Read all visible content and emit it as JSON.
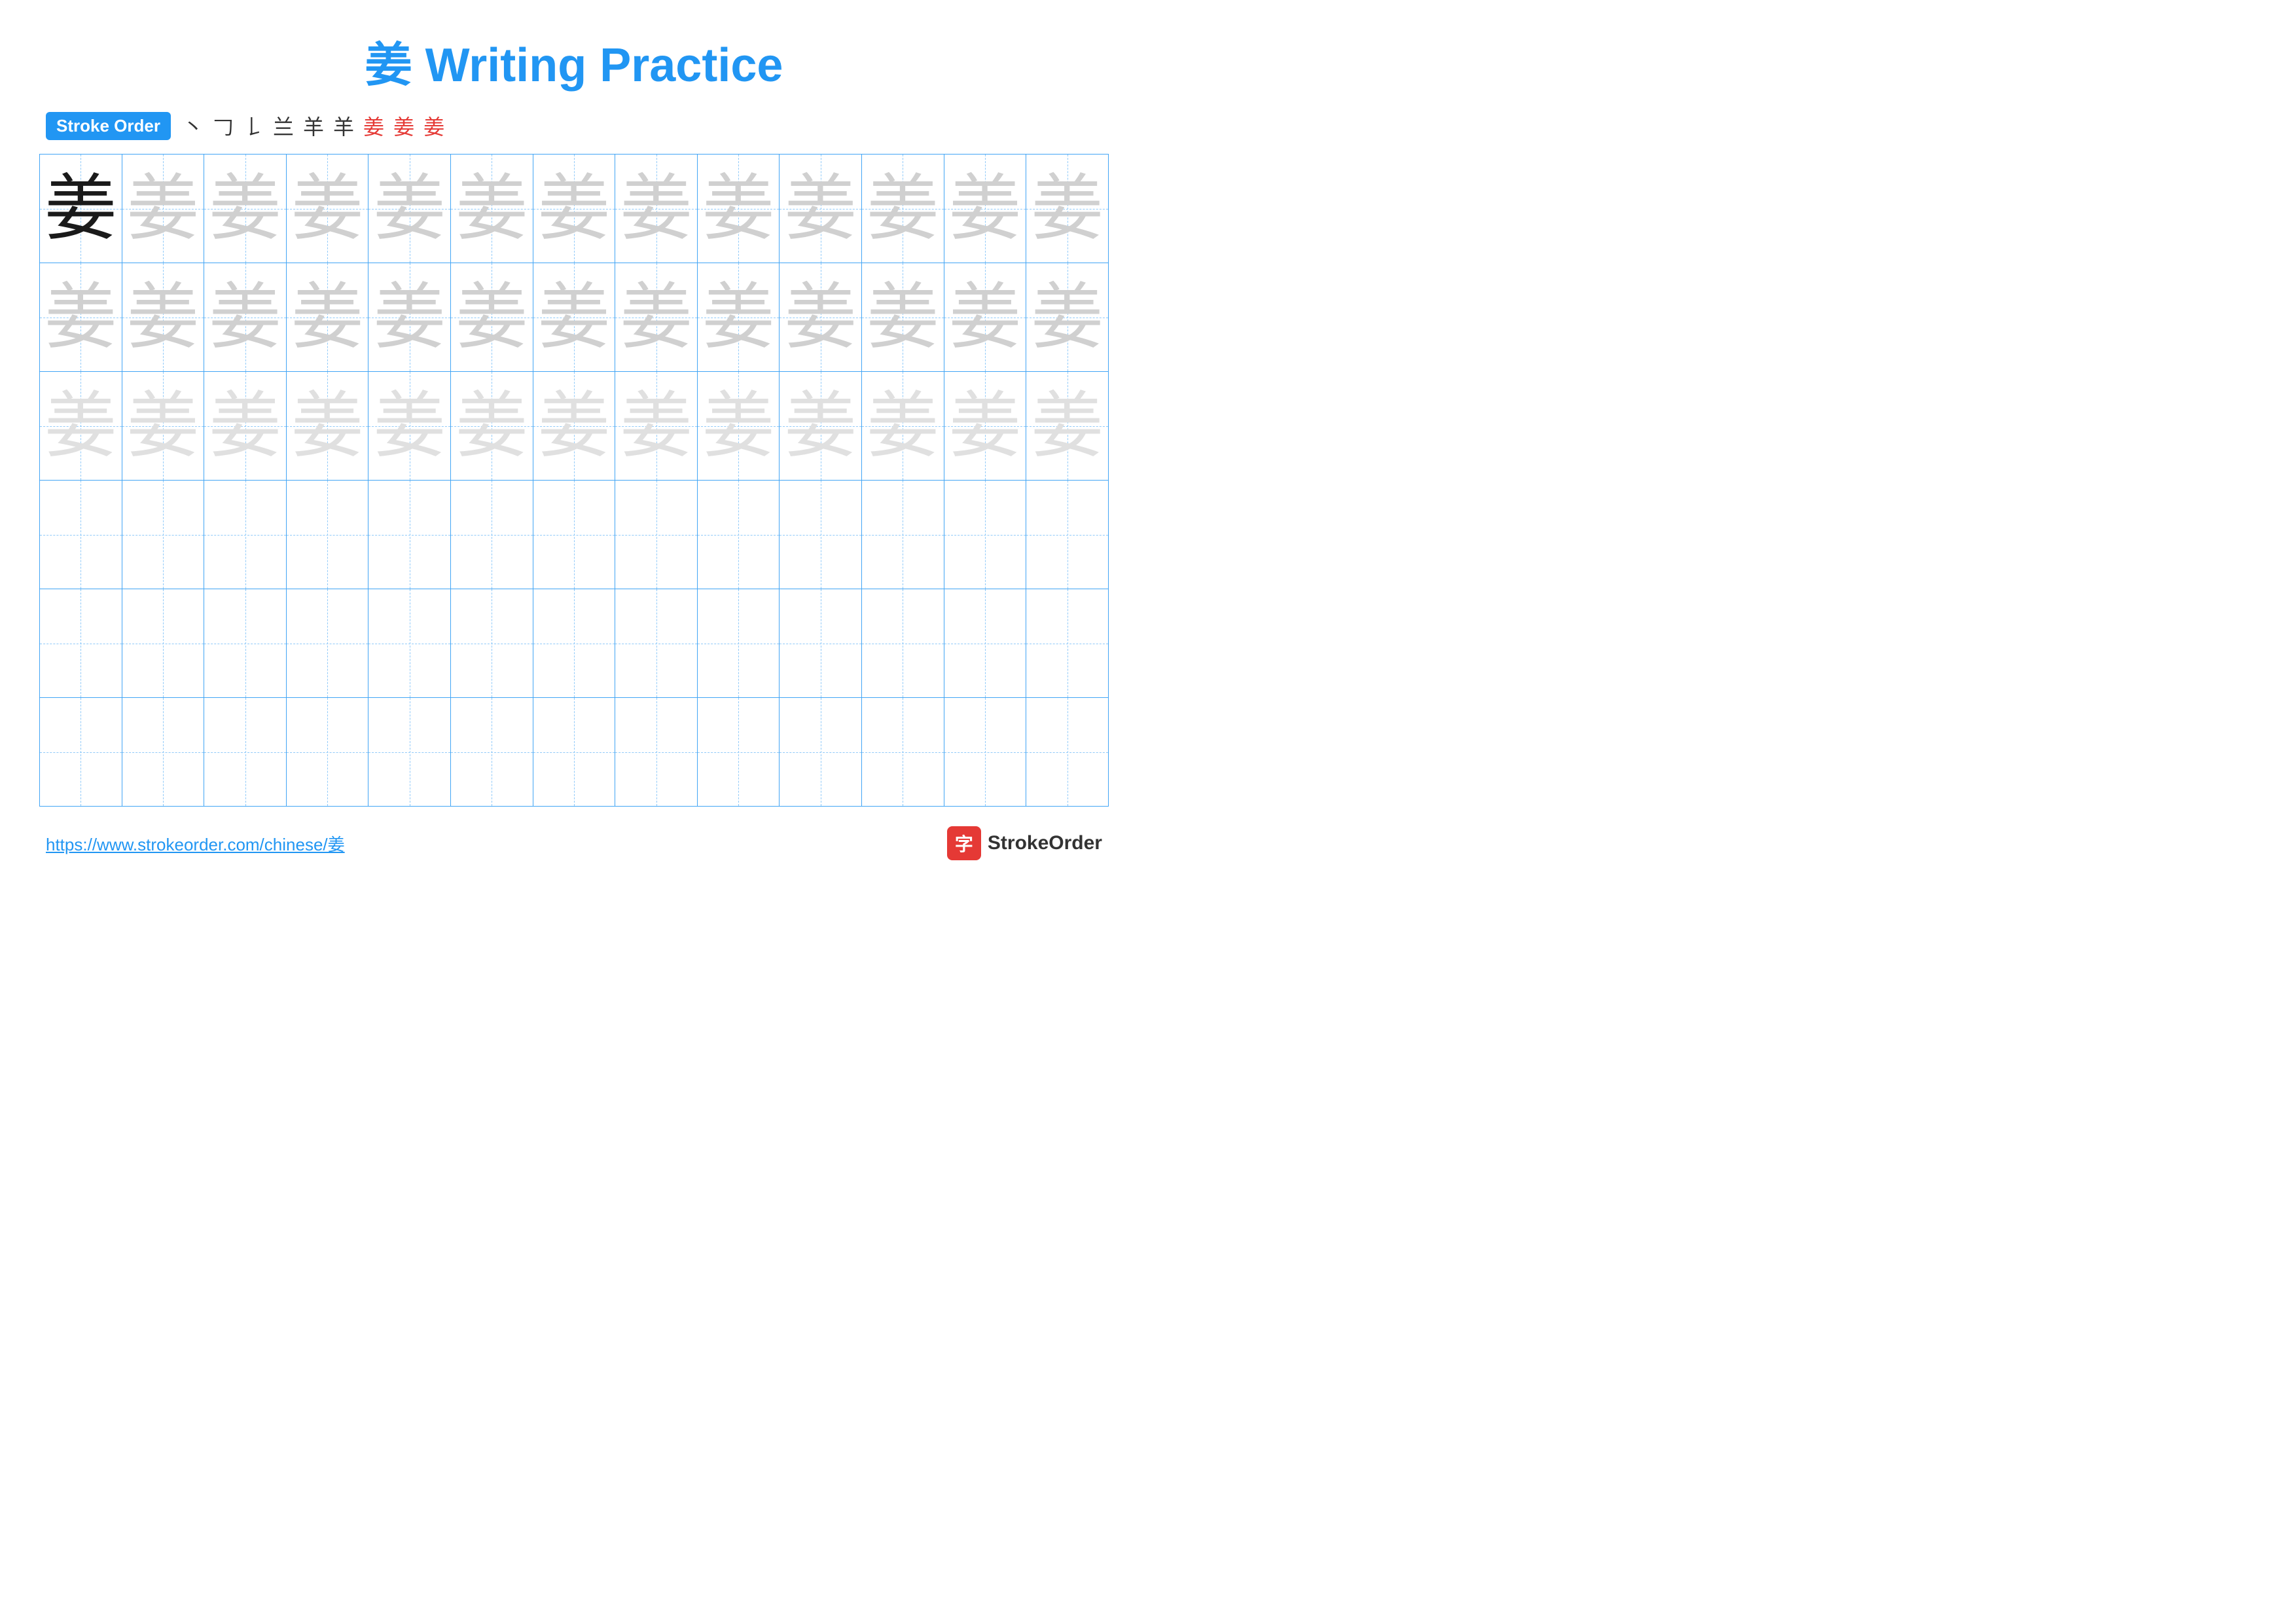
{
  "title": "姜 Writing Practice",
  "stroke_order": {
    "label": "Stroke Order",
    "steps": [
      "丶",
      "𠃌",
      "𠄌",
      "兰",
      "羊",
      "羊̈",
      "姜̈",
      "姜",
      "姜"
    ],
    "red_from": 6
  },
  "character": "姜",
  "rows": [
    {
      "type": "practice",
      "cells": 13
    },
    {
      "type": "practice",
      "cells": 13
    },
    {
      "type": "practice",
      "cells": 13
    },
    {
      "type": "empty",
      "cells": 13
    },
    {
      "type": "empty",
      "cells": 13
    },
    {
      "type": "empty",
      "cells": 13
    }
  ],
  "footer": {
    "url": "https://www.strokeorder.com/chinese/姜",
    "logo_char": "字",
    "logo_name": "StrokeOrder"
  }
}
